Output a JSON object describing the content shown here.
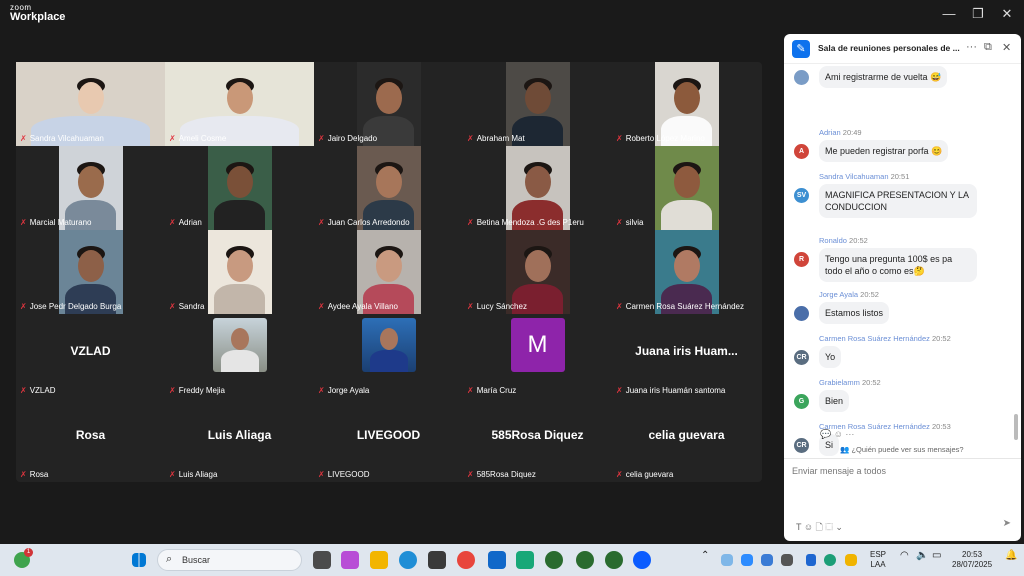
{
  "app": {
    "logo_line1": "zoom",
    "logo_line2": "Workplace",
    "minimize": "—",
    "restore": "❐",
    "close": "✕"
  },
  "participants": [
    {
      "name": "Sandra Vilcahuaman",
      "video": true
    },
    {
      "name": "Ameli Cosme",
      "video": true,
      "active": true
    },
    {
      "name": "Jairo Delgado",
      "video": true
    },
    {
      "name": "Abraham Mat",
      "video": true
    },
    {
      "name": "Roberto López Marino",
      "video": true
    },
    {
      "name": "Marcial Maturano",
      "video": true
    },
    {
      "name": "Adrian",
      "video": true
    },
    {
      "name": "Juan Carlos Arredondo",
      "video": true
    },
    {
      "name": "Betina Mendoza .G des P1eru",
      "video": true
    },
    {
      "name": "silvia",
      "video": true
    },
    {
      "name": "Jose Pedr Delgado Burga",
      "video": true
    },
    {
      "name": "Sandra",
      "video": true
    },
    {
      "name": "Aydee Ayala Villano",
      "video": true
    },
    {
      "name": "Lucy Sánchez",
      "video": true
    },
    {
      "name": "Carmen Rosa Suárez Hernández",
      "video": true
    },
    {
      "name": "VZLAD",
      "display": "VZLAD"
    },
    {
      "name": "Freddy Mejia",
      "avatar": "photo"
    },
    {
      "name": "Jorge Ayala",
      "avatar": "photo"
    },
    {
      "name": "María Cruz",
      "avatar": "letter",
      "letter": "M"
    },
    {
      "name": "Juana iris Huamán santoma",
      "display": "Juana iris Huam..."
    },
    {
      "name": "Rosa",
      "display": "Rosa"
    },
    {
      "name": "Luis Aliaga",
      "display": "Luis Aliaga"
    },
    {
      "name": "LIVEGOOD",
      "display": "LIVEGOOD"
    },
    {
      "name": "585Rosa Diquez",
      "display": "585Rosa Diquez"
    },
    {
      "name": "celia guevara",
      "display": "celia guevara"
    }
  ],
  "chat": {
    "title": "Sala de reuniones personales de ...",
    "more": "···",
    "popout": "⧉",
    "close": "✕",
    "messages": [
      {
        "sender": "",
        "time": "",
        "initials": "",
        "color": "#7a9cc6",
        "text": "Ami registrarme de vuelta 😅"
      },
      {
        "sender": "Adrian",
        "time": "20:49",
        "initials": "A",
        "color": "#d0453a",
        "text": "Me pueden registrar porfa 😊"
      },
      {
        "sender": "Sandra Vilcahuaman",
        "time": "20:51",
        "initials": "SV",
        "color": "#3d8fd1",
        "text": "MAGNIFICA PRESENTACION Y LA CONDUCCION"
      },
      {
        "sender": "Ronaldo",
        "time": "20:52",
        "initials": "R",
        "color": "#d0453a",
        "text": "Tengo una pregunta 100$ es pa todo el año o como es🤔"
      },
      {
        "sender": "Jorge Ayala",
        "time": "20:52",
        "initials": "",
        "color": "#4a6ea9",
        "text": "Estamos listos"
      },
      {
        "sender": "Carmen Rosa Suárez Hernández",
        "time": "20:52",
        "initials": "CR",
        "color": "#5a6d80",
        "text": "Yo"
      },
      {
        "sender": "Grabielamm",
        "time": "20:52",
        "initials": "G",
        "color": "#3ba55c",
        "text": "Bien"
      },
      {
        "sender": "Carmen Rosa Suárez Hernández",
        "time": "20:53",
        "initials": "CR",
        "color": "#5a6d80",
        "text": "Si"
      }
    ],
    "reactions": "💬 ☺ ···",
    "who_can_see": "¿Quién puede ver sus mensajes?",
    "input_placeholder": "Enviar mensaje a todos",
    "tools": "T ☺ 🗋 ⬚ ⌄",
    "send": "➤"
  },
  "taskbar": {
    "search_placeholder": "Buscar",
    "lang1": "ESP",
    "lang2": "LAA",
    "time": "20:53",
    "date": "28/07/2025",
    "notification_badge": "1"
  }
}
